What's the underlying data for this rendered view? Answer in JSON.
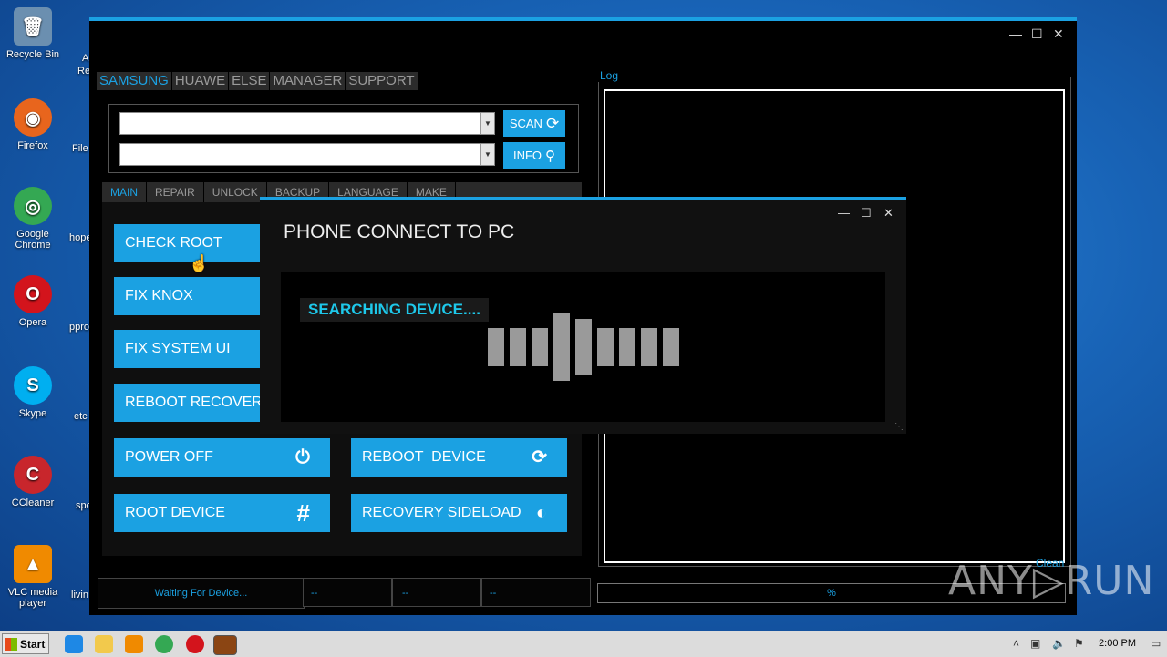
{
  "desktop": {
    "icons": [
      {
        "label": "Recycle Bin",
        "glyph": "🗑",
        "color": "#6b8fb0"
      },
      {
        "label": "Firefox",
        "glyph": "◉",
        "color": "#e8651d"
      },
      {
        "label": "Google Chrome",
        "glyph": "◎",
        "color": "#34a853"
      },
      {
        "label": "Opera",
        "glyph": "O",
        "color": "#d3141c"
      },
      {
        "label": "Skype",
        "glyph": "S",
        "color": "#00aff0"
      },
      {
        "label": "CCleaner",
        "glyph": "C",
        "color": "#c8262c"
      },
      {
        "label": "VLC media player",
        "glyph": "▲",
        "color": "#f08a00"
      }
    ],
    "partial_labels": [
      "A",
      "Re",
      "File",
      "hope",
      "ppro",
      "etc",
      "spo",
      "livin"
    ]
  },
  "app": {
    "top_tabs": [
      "SAMSUNG",
      "HUAWE",
      "ELSE",
      "MANAGER",
      "SUPPORT"
    ],
    "combo1_value": "",
    "combo2_value": "",
    "scan_label": "SCAN",
    "info_label": "INFO",
    "sub_tabs": [
      "MAIN",
      "REPAIR",
      "UNLOCK",
      "BACKUP",
      "LANGUAGE",
      "MAKE"
    ],
    "buttons": {
      "check_root": "CHECK ROOT",
      "fix_knox": "FIX KNOX",
      "fix_system_ui": "FIX SYSTEM UI",
      "reboot_recovery": "REBOOT RECOVERY",
      "power_off": "POWER OFF",
      "reboot_device": "REBOOT  DEVICE",
      "root_device": "ROOT DEVICE",
      "recovery_sideload": "RECOVERY SIDELOAD"
    },
    "log_label": "Log",
    "clean_label": "Clean",
    "status": {
      "main": "Waiting For Device...",
      "s2": "--",
      "s3": "--",
      "s4": "--",
      "progress": "%"
    }
  },
  "dialog": {
    "title": "PHONE CONNECT TO PC",
    "message": "SEARCHING DEVICE....",
    "bar_count": 9
  },
  "watermark": "ANY▷RUN",
  "taskbar": {
    "start_label": "Start",
    "clock": "2:00 PM"
  },
  "colors": {
    "accent": "#1ba1e2",
    "searching_text": "#1ec8ea"
  }
}
